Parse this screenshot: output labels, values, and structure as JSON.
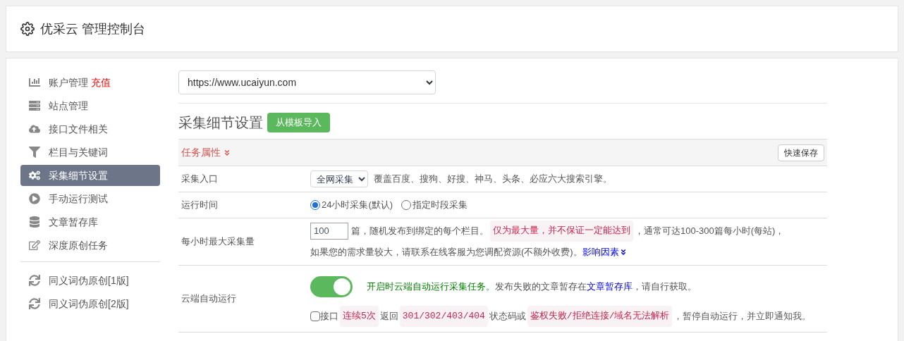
{
  "header": {
    "title": "优采云 管理控制台"
  },
  "sidebar": {
    "groups": [
      [
        {
          "label": "账户管理",
          "badge": "充值",
          "selected": false
        },
        {
          "label": "站点管理",
          "selected": false
        },
        {
          "label": "接口文件相关",
          "selected": false
        },
        {
          "label": "栏目与关键词",
          "selected": false
        },
        {
          "label": "采集细节设置",
          "selected": true
        },
        {
          "label": "手动运行测试",
          "selected": false
        },
        {
          "label": "文章暂存库",
          "selected": false
        },
        {
          "label": "深度原创任务",
          "selected": false
        }
      ],
      [
        {
          "label": "同义词伪原创[1版]",
          "selected": false
        },
        {
          "label": "同义词伪原创[2版]",
          "selected": false
        }
      ]
    ]
  },
  "site_select": {
    "value": "https://www.ucaiyun.com"
  },
  "section": {
    "title": "采集细节设置",
    "import_button": "从模板导入"
  },
  "table": {
    "header": {
      "label": "任务属性",
      "save_button": "快速保存"
    },
    "rows": [
      {
        "kind": "select",
        "label": "采集入口",
        "value": "全网采集",
        "lines": [
          [
            {
              "kind": "text",
              "text": "覆盖百度、搜狗、好搜、神马、头条、必应六大搜索引擎。"
            }
          ]
        ]
      },
      {
        "kind": "radio",
        "label": "运行时间",
        "options": [
          {
            "label": "24小时采集(默认)",
            "selected": true
          },
          {
            "label": "指定时段采集",
            "selected": false
          }
        ]
      },
      {
        "kind": "number",
        "label": "每小时最大采集量",
        "value": "100",
        "lines": [
          [
            {
              "kind": "text",
              "text": "篇，随机发布到绑定的每个栏目。"
            },
            {
              "kind": "code",
              "text": "仅为最大量，并不保证一定能达到"
            },
            {
              "kind": "text",
              "text": "，通常可达100-300篇每小时(每站)，"
            }
          ],
          [
            {
              "kind": "text",
              "text": "如果您的需求量较大，请联系在线客服为您调配资源(不额外收费)。"
            },
            {
              "kind": "link",
              "text": "影响因素"
            }
          ]
        ]
      },
      {
        "kind": "toggle",
        "label": "云端自动运行",
        "on": true,
        "lines": [
          [
            {
              "kind": "note",
              "text": "开启时云端自动运行采集任务。"
            },
            {
              "kind": "text",
              "text": "发布失败的文章暂存在"
            },
            {
              "kind": "link",
              "text": "文章暂存库"
            },
            {
              "kind": "text",
              "text": "，请自行获取。"
            }
          ]
        ],
        "check": {
          "checked": false,
          "parts": [
            {
              "kind": "text",
              "text": "接口"
            },
            {
              "kind": "code",
              "text": "连续5次"
            },
            {
              "kind": "text",
              "text": "返回"
            },
            {
              "kind": "code",
              "text": "301/302/403/404"
            },
            {
              "kind": "text",
              "text": "状态码或"
            },
            {
              "kind": "code",
              "text": "鉴权失败/拒绝连接/域名无法解析"
            },
            {
              "kind": "text",
              "text": "，暂停自动运行，并立即通知我。"
            }
          ]
        }
      }
    ]
  }
}
